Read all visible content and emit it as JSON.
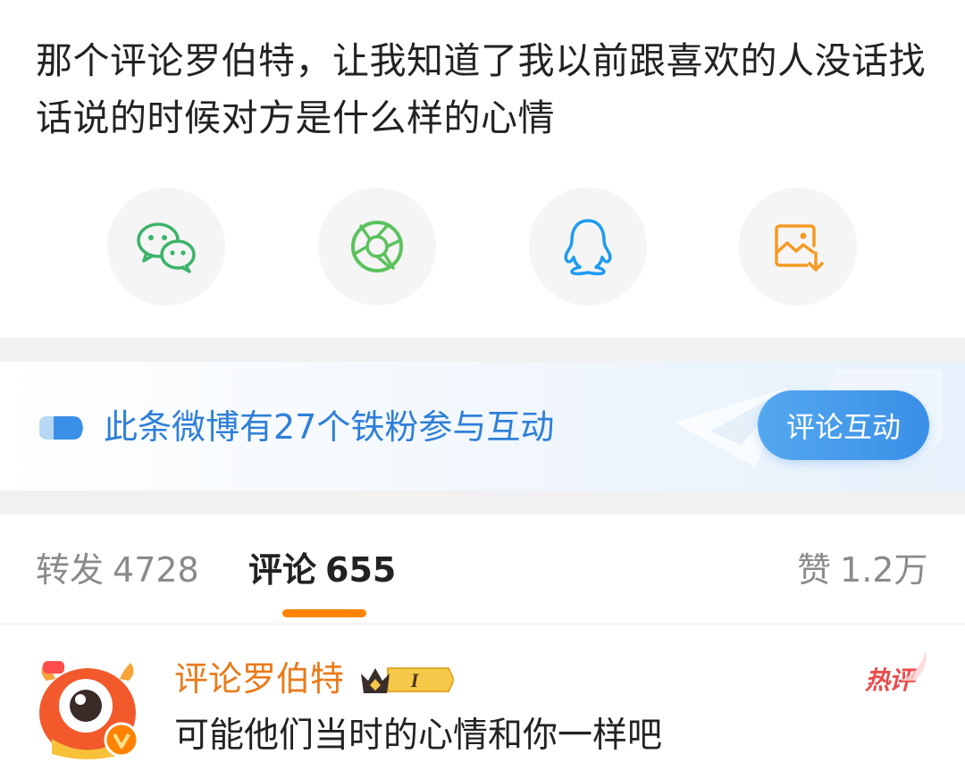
{
  "post": {
    "text": "那个评论罗伯特，让我知道了我以前跟喜欢的人没话找话说的时候对方是什么样的心情"
  },
  "share": [
    {
      "icon": "wechat-icon",
      "color": "#3cb36a"
    },
    {
      "icon": "moments-icon",
      "color": "#5bc25c"
    },
    {
      "icon": "qq-icon",
      "color": "#1e9bf0"
    },
    {
      "icon": "save-image-icon",
      "color": "#f59a23"
    }
  ],
  "fan_banner": {
    "text": "此条微博有27个铁粉参与互动",
    "button_label": "评论互动"
  },
  "tabs": {
    "reposts": {
      "label": "转发",
      "count": "4728"
    },
    "comments": {
      "label": "评论",
      "count": "655"
    },
    "likes": {
      "label": "赞",
      "count": "1.2万"
    }
  },
  "comment": {
    "username": "评论罗伯特",
    "badge_level": "I",
    "tag": "热评",
    "text": "可能他们当时的心情和你一样吧"
  },
  "colors": {
    "accent_orange": "#ff8200",
    "username_orange": "#ea7a1a",
    "link_blue": "#2e7fd9",
    "hot_red": "#ea4b4b"
  }
}
